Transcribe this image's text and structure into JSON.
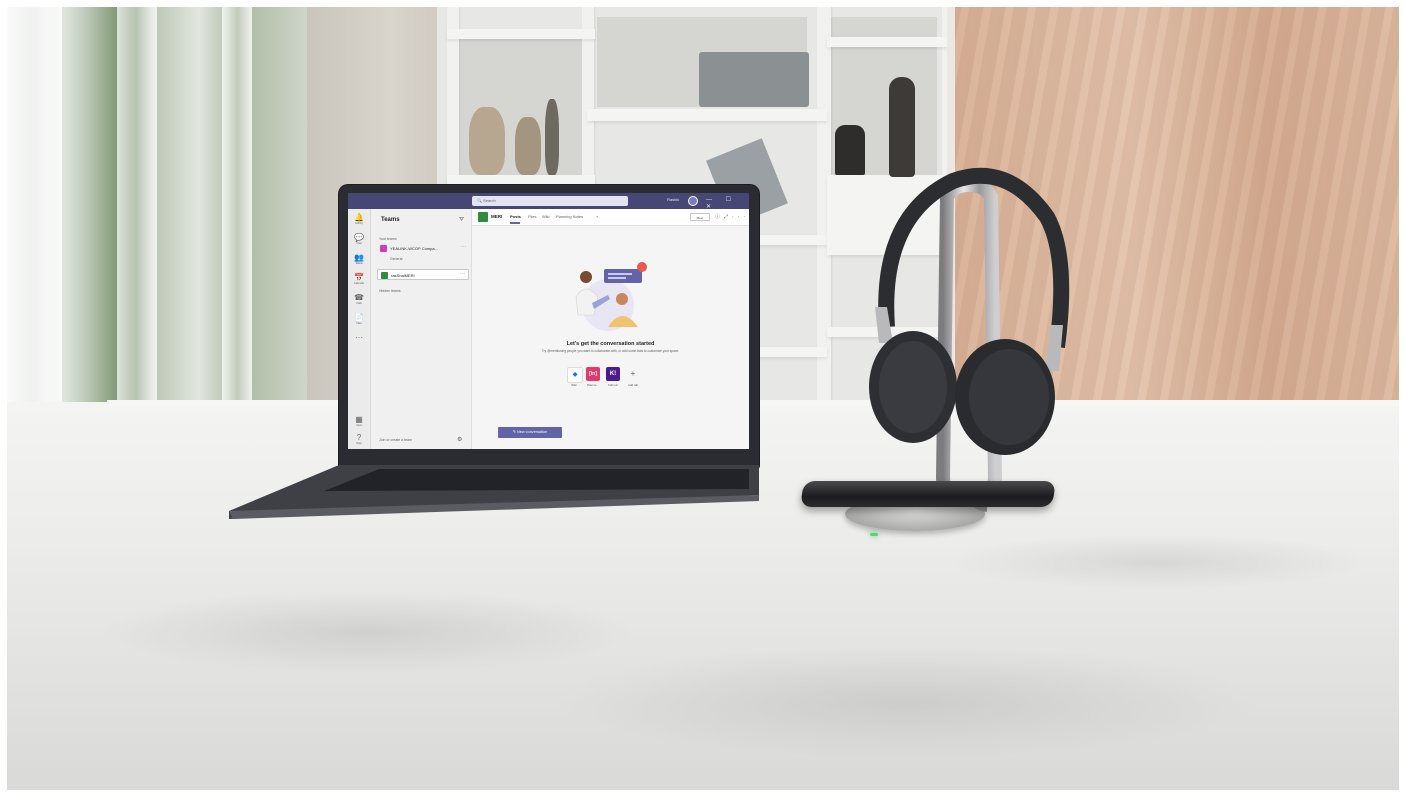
{
  "teams_app": {
    "search_placeholder": "Search",
    "user_name": "Rashik",
    "window_controls": "— ☐ ✕",
    "rail": [
      {
        "icon": "bell-icon",
        "glyph": "🔔",
        "label": "Activity"
      },
      {
        "icon": "chat-icon",
        "glyph": "💬",
        "label": "Chat"
      },
      {
        "icon": "teams-icon",
        "glyph": "👥",
        "label": "Teams"
      },
      {
        "icon": "calendar-icon",
        "glyph": "📅",
        "label": "Calendar"
      },
      {
        "icon": "phone-icon",
        "glyph": "☎",
        "label": "Calls"
      },
      {
        "icon": "files-icon",
        "glyph": "📄",
        "label": "Files"
      },
      {
        "icon": "more-icon",
        "glyph": "···",
        "label": ""
      }
    ],
    "rail_bottom": [
      {
        "icon": "apps-icon",
        "glyph": "▦",
        "label": "Apps"
      },
      {
        "icon": "help-icon",
        "glyph": "?",
        "label": "Help"
      }
    ],
    "sidebar": {
      "title": "Teams",
      "section_label": "Your teams",
      "teams": [
        {
          "name": "YEALINK-WCOP Compa...",
          "color": "#d13bb8",
          "channel": "General"
        },
        {
          "name": "rasShalMERI",
          "color": "#2f8c3f",
          "channel": ""
        }
      ],
      "hidden_label": "Hidden teams",
      "join_label": "Join or create a team"
    },
    "channel_header": {
      "name": "MERI",
      "tabs": [
        "Posts",
        "Files",
        "Wiki",
        "Planning Notes",
        "+"
      ],
      "meet_label": "Meet"
    },
    "empty_state": {
      "heading": "Let's get the conversation started",
      "subtext": "Try @mentioning people you want to collaborate with, or add some tabs to customize your space."
    },
    "apps": [
      {
        "label": "Wiki",
        "glyph": "◆",
        "color": "#ffffff",
        "fg": "#1a73e8"
      },
      {
        "label": "Planne...",
        "glyph": "[in]",
        "color": "#e03a6e",
        "fg": "#ffffff"
      },
      {
        "label": "Kahoot!",
        "glyph": "K!",
        "color": "#4b1a8c",
        "fg": "#ffffff"
      },
      {
        "label": "Add tab",
        "glyph": "+",
        "color": "#f5f5f5",
        "fg": "#616161"
      }
    ],
    "new_conversation_label": "New conversation"
  }
}
